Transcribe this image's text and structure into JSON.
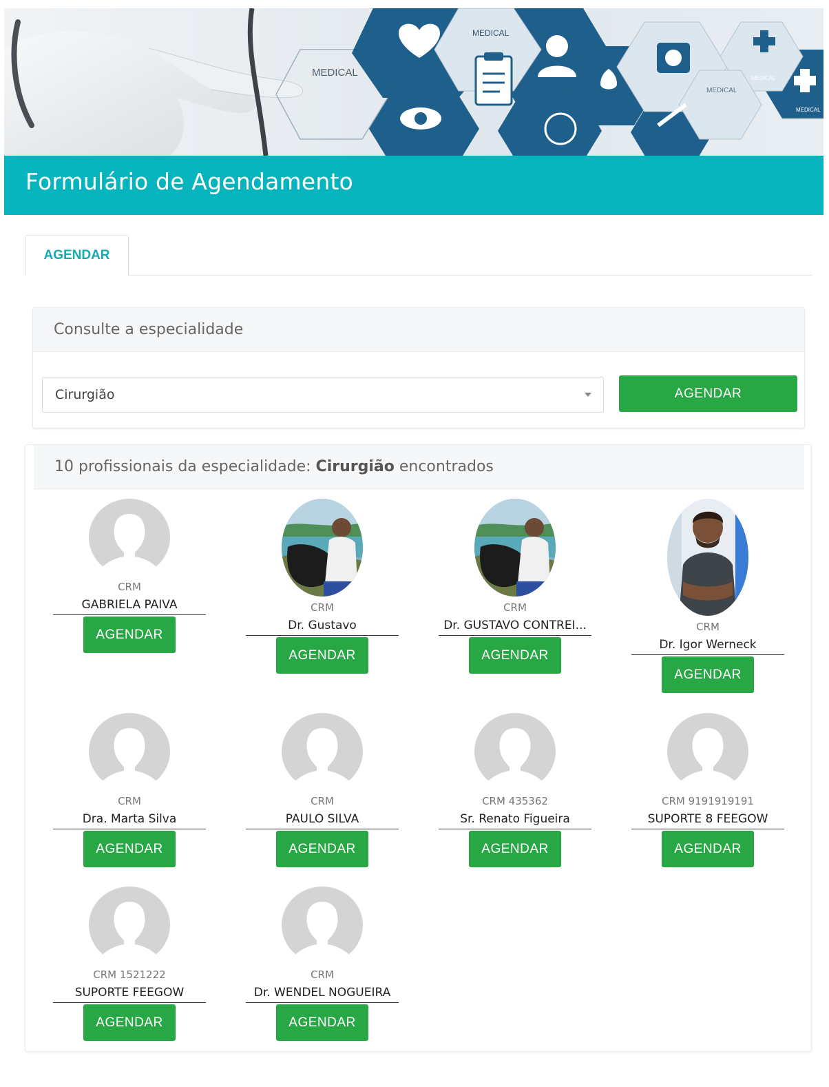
{
  "banner": {
    "labels": [
      "MEDICAL",
      "MEDICAL",
      "MEDICAL",
      "MEDICAL",
      "MEDICAL"
    ]
  },
  "header": {
    "title": "Formulário de Agendamento"
  },
  "tabs": [
    {
      "label": "AGENDAR"
    }
  ],
  "search_panel": {
    "heading": "Consulte a especialidade",
    "selected_specialty": "Cirurgião",
    "button_label": "AGENDAR"
  },
  "results_panel": {
    "count": "10",
    "prefix": "profissionais da especialidade:",
    "specialty": "Cirurgião",
    "suffix": "encontrados"
  },
  "doctors": [
    {
      "crm": "CRM",
      "name": "GABRIELA PAIVA",
      "button": "AGENDAR",
      "avatar": "placeholder-avatar-icon"
    },
    {
      "crm": "CRM",
      "name": "Dr. Gustavo",
      "button": "AGENDAR",
      "avatar": "photo"
    },
    {
      "crm": "CRM",
      "name": "Dr. GUSTAVO CONTREI...",
      "button": "AGENDAR",
      "avatar": "photo"
    },
    {
      "crm": "CRM",
      "name": "Dr. Igor Werneck",
      "button": "AGENDAR",
      "avatar": "photo"
    },
    {
      "crm": "CRM",
      "name": "Dra. Marta Silva",
      "button": "AGENDAR",
      "avatar": "placeholder-avatar-icon"
    },
    {
      "crm": "CRM",
      "name": "PAULO SILVA",
      "button": "AGENDAR",
      "avatar": "placeholder-avatar-icon"
    },
    {
      "crm": "CRM 435362",
      "name": "Sr. Renato Figueira",
      "button": "AGENDAR",
      "avatar": "placeholder-avatar-icon"
    },
    {
      "crm": "CRM 9191919191",
      "name": "SUPORTE 8 FEEGOW",
      "button": "AGENDAR",
      "avatar": "placeholder-avatar-icon"
    },
    {
      "crm": "CRM 1521222",
      "name": "SUPORTE FEEGOW",
      "button": "AGENDAR",
      "avatar": "placeholder-avatar-icon"
    },
    {
      "crm": "CRM",
      "name": "Dr. WENDEL NOGUEIRA",
      "button": "AGENDAR",
      "avatar": "placeholder-avatar-icon"
    }
  ],
  "colors": {
    "brand": "#05b4bd",
    "tab_text": "#17aab1",
    "button": "#28a745",
    "hex_dark": "#1f5f8b",
    "hex_light": "#dce6ee"
  }
}
